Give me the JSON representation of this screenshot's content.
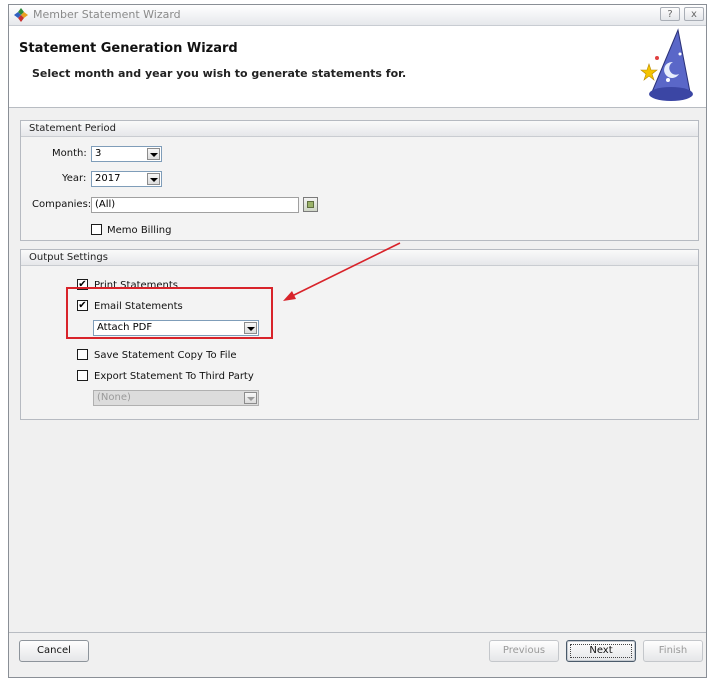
{
  "window": {
    "title": "Member Statement Wizard",
    "help_label": "?",
    "close_label": "x"
  },
  "header": {
    "title": "Statement Generation Wizard",
    "subtitle": "Select month and year you wish to generate statements for."
  },
  "statement_period": {
    "title": "Statement Period",
    "month_label": "Month:",
    "month_value": "3",
    "year_label": "Year:",
    "year_value": "2017",
    "companies_label": "Companies:",
    "companies_value": "(All)",
    "memo_billing_label": "Memo Billing",
    "memo_billing_checked": false
  },
  "output_settings": {
    "title": "Output Settings",
    "print_label": "Print Statements",
    "print_checked": true,
    "email_label": "Email Statements",
    "email_checked": true,
    "email_format_value": "Attach PDF",
    "save_copy_label": "Save Statement Copy To File",
    "save_copy_checked": false,
    "export_label": "Export Statement To Third Party",
    "export_checked": false,
    "export_value": "(None)"
  },
  "check_mark": "✔",
  "footer": {
    "cancel": "Cancel",
    "previous": "Previous",
    "next": "Next",
    "finish": "Finish"
  },
  "colors": {
    "annotation": "#d8232a",
    "panel": "#f0f0f0"
  }
}
